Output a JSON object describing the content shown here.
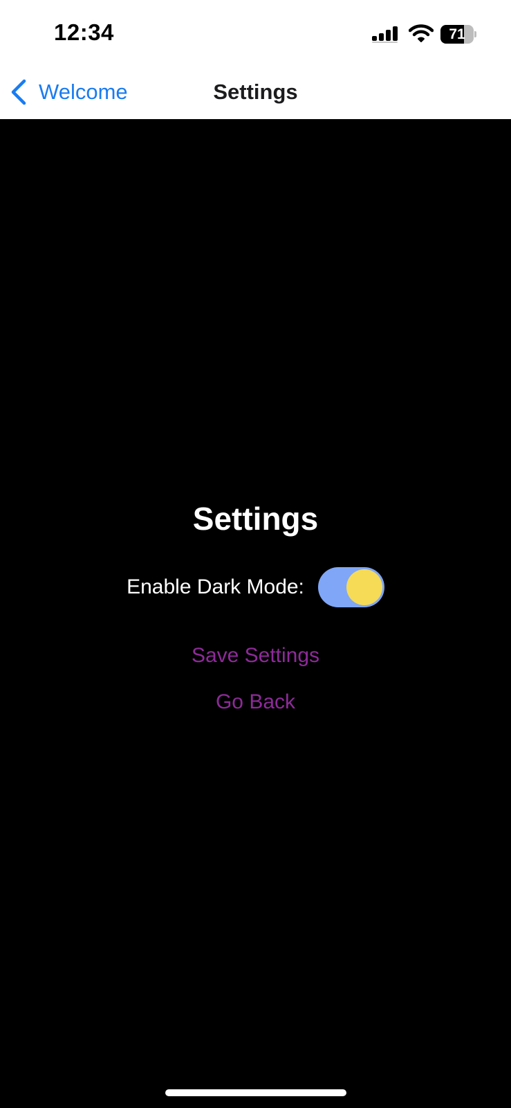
{
  "status_bar": {
    "time": "12:34",
    "battery_level": "71",
    "battery_fraction": 0.71,
    "icons": [
      "signal-icon",
      "wifi-icon",
      "battery-icon"
    ]
  },
  "nav": {
    "back_label": "Welcome",
    "title": "Settings",
    "back_icon": "chevron-left-icon"
  },
  "content": {
    "heading": "Settings",
    "dark_mode_label": "Enable Dark Mode:",
    "dark_mode_enabled": true,
    "save_label": "Save Settings",
    "go_back_label": "Go Back"
  },
  "colors": {
    "accent_link": "#1a7cf0",
    "button_text": "#8e2a99",
    "toggle_track": "#7fa6f7",
    "toggle_knob": "#f6db57",
    "background": "#000000"
  }
}
